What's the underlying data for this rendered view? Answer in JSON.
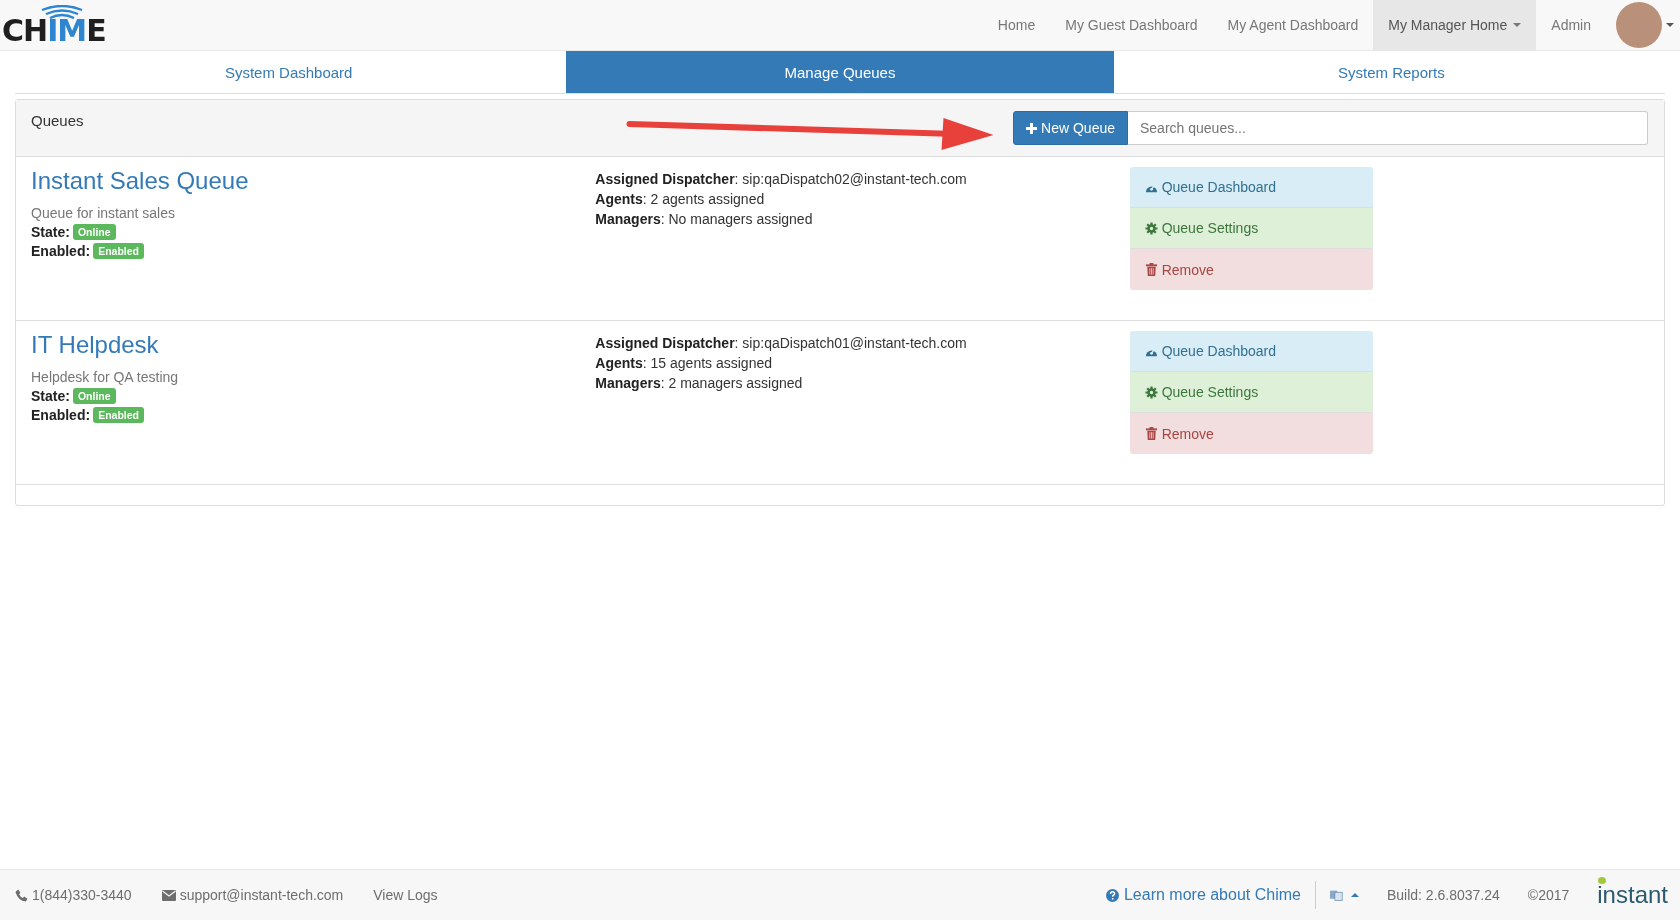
{
  "navbar": {
    "logo": [
      {
        "text": "CH",
        "accent": false
      },
      {
        "text": "IM",
        "accent": true
      },
      {
        "text": "E",
        "accent": false
      }
    ],
    "items": [
      {
        "label": "Home",
        "selected": false,
        "dropdown": false
      },
      {
        "label": "My Guest Dashboard",
        "selected": false,
        "dropdown": false
      },
      {
        "label": "My Agent Dashboard",
        "selected": false,
        "dropdown": false
      },
      {
        "label": "My Manager Home",
        "selected": true,
        "dropdown": true
      },
      {
        "label": "Admin",
        "selected": false,
        "dropdown": false
      }
    ]
  },
  "tabs": [
    {
      "label": "System Dashboard",
      "selected": false
    },
    {
      "label": "Manage Queues",
      "selected": true
    },
    {
      "label": "System Reports",
      "selected": false
    }
  ],
  "panel": {
    "title": "Queues",
    "new_button": "New Queue",
    "search": {
      "placeholder": "Search queues..."
    }
  },
  "queues": [
    {
      "name": "Instant Sales Queue",
      "description": "Queue for instant sales",
      "fields": [
        {
          "label": "State:",
          "badge": "Online",
          "color": "#5cb85c"
        },
        {
          "label": "Enabled:",
          "badge": "Enabled",
          "color": "#5cb85c"
        }
      ],
      "details": [
        "**Assigned Dispatcher**: sip:qaDispatch02@instant-tech.com",
        "**Agents**: 2 agents assigned",
        "**Managers**: No managers assigned"
      ],
      "actions": [
        {
          "label": "Queue Dashboard",
          "kind": "dashboard"
        },
        {
          "label": "Queue Settings",
          "kind": "settings"
        },
        {
          "label": "Remove",
          "kind": "remove"
        }
      ]
    },
    {
      "name": "IT Helpdesk",
      "description": "Helpdesk for QA testing",
      "fields": [
        {
          "label": "State:",
          "badge": "Online",
          "color": "#5cb85c"
        },
        {
          "label": "Enabled:",
          "badge": "Enabled",
          "color": "#5cb85c"
        }
      ],
      "details": [
        "**Assigned Dispatcher**: sip:qaDispatch01@instant-tech.com",
        "**Agents**: 15 agents assigned",
        "**Managers**: 2 managers assigned"
      ],
      "actions": [
        {
          "label": "Queue Dashboard",
          "kind": "dashboard"
        },
        {
          "label": "Queue Settings",
          "kind": "settings"
        },
        {
          "label": "Remove",
          "kind": "remove"
        }
      ]
    }
  ],
  "footer": {
    "phone": "1(844)330-3440",
    "email": "support@instant-tech.com",
    "logs": "View Logs",
    "learn_more": "Learn more about Chime",
    "build": "Build: 2.6.8037.24",
    "copyright": "©2017",
    "brand": "instant"
  }
}
